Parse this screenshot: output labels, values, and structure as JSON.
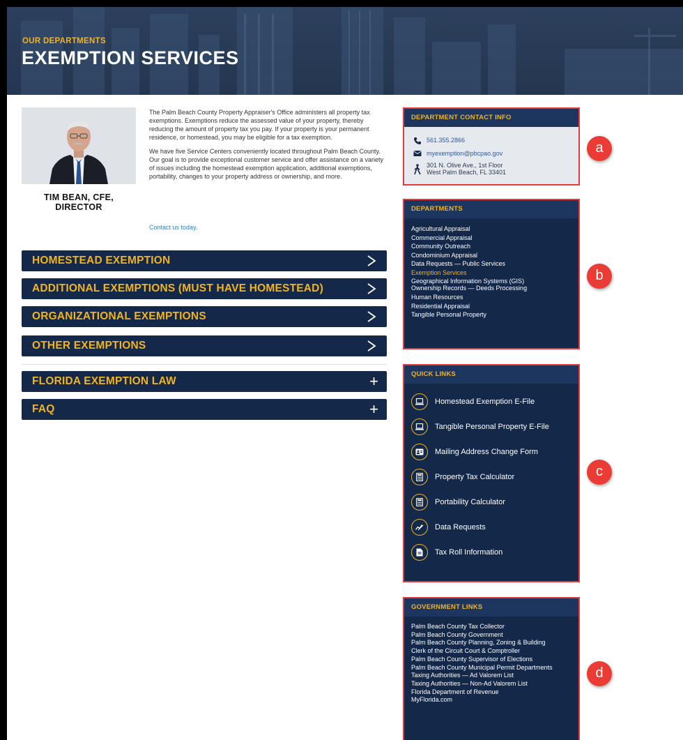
{
  "hero": {
    "kicker": "OUR DEPARTMENTS",
    "title": "EXEMPTION SERVICES"
  },
  "director": {
    "name_line1": "TIM BEAN, CFE,",
    "name_line2": "DIRECTOR"
  },
  "intro": {
    "paragraph1": "The Palm Beach County Property Appraiser's Office administers all property tax exemptions. Exemptions reduce the assessed value of your property, thereby reducing the amount of property tax you pay. If your property is your permanent residence, or homestead, you may be eligible for a tax exemption.",
    "paragraph2": "We have five Service Centers conveniently located throughout Palm Beach County. Our goal is to provide exceptional customer service and offer assistance on a variety of issues including the homestead exemption application, additional exemptions, portability, changes to your property address or ownership, and more.",
    "contact_link": "Contact us today",
    "contact_period": "."
  },
  "accordion": {
    "items": [
      {
        "label": "HOMESTEAD EXEMPTION",
        "icon": "chevron-right-icon"
      },
      {
        "label": "ADDITIONAL EXEMPTIONS (MUST HAVE HOMESTEAD)",
        "icon": "chevron-right-icon"
      },
      {
        "label": "ORGANIZATIONAL EXEMPTIONS",
        "icon": "chevron-right-icon"
      },
      {
        "label": "OTHER EXEMPTIONS",
        "icon": "chevron-right-icon"
      },
      {
        "label": "FLORIDA EXEMPTION LAW",
        "icon": "plus-icon"
      },
      {
        "label": "FAQ",
        "icon": "plus-icon"
      }
    ],
    "plus": "+"
  },
  "contact_info": {
    "heading": "DEPARTMENT CONTACT INFO",
    "phone": "561.355.2866",
    "email": "myexemption@pbcpao.gov",
    "address_line1": "301 N. Olive Ave., 1st Floor",
    "address_line2": "West Palm Beach, FL 33401"
  },
  "departments": {
    "heading": "DEPARTMENTS",
    "items": [
      "Agricultural Appraisal",
      "Commercial Appraisal",
      "Community Outreach",
      "Condominium Appraisal",
      "Data Requests — Public Services",
      "Exemption Services",
      "Geographical Information Systems (GIS)",
      "Ownership Records — Deeds Processing",
      "Human Resources",
      "Residential Appraisal",
      "Tangible Personal Property"
    ],
    "active_index": 5
  },
  "quick_links": {
    "heading": "QUICK LINKS",
    "items": [
      {
        "label": "Homestead Exemption E-File",
        "icon": "laptop-icon"
      },
      {
        "label": "Tangible Personal Property E-File",
        "icon": "laptop-icon"
      },
      {
        "label": "Mailing Address Change Form",
        "icon": "id-card-icon"
      },
      {
        "label": "Property Tax Calculator",
        "icon": "calculator-icon"
      },
      {
        "label": "Portability Calculator",
        "icon": "calculator-icon"
      },
      {
        "label": "Data Requests",
        "icon": "chart-icon"
      },
      {
        "label": "Tax Roll Information",
        "icon": "document-icon"
      }
    ]
  },
  "government_links": {
    "heading": "GOVERNMENT LINKS",
    "items": [
      "Palm Beach County Tax Collector",
      "Palm Beach County Government",
      "Palm Beach County Planning, Zoning & Building",
      "Clerk of the Circuit Court & Comptroller",
      "Palm Beach County Supervisor of Elections",
      "Palm Beach County Municipal Permit Departments",
      "Taxing Authorities — Ad Valorem List",
      "Taxing Authorities — Non-Ad Valorem List",
      "Florida Department of Revenue",
      "MyFlorida.com"
    ]
  },
  "markers": [
    "a",
    "b",
    "c",
    "d"
  ],
  "colors": {
    "navy": "#14294a",
    "gold": "#f0b323",
    "marker_red": "#ea3b34",
    "highlight_border": "#e23b3b"
  }
}
